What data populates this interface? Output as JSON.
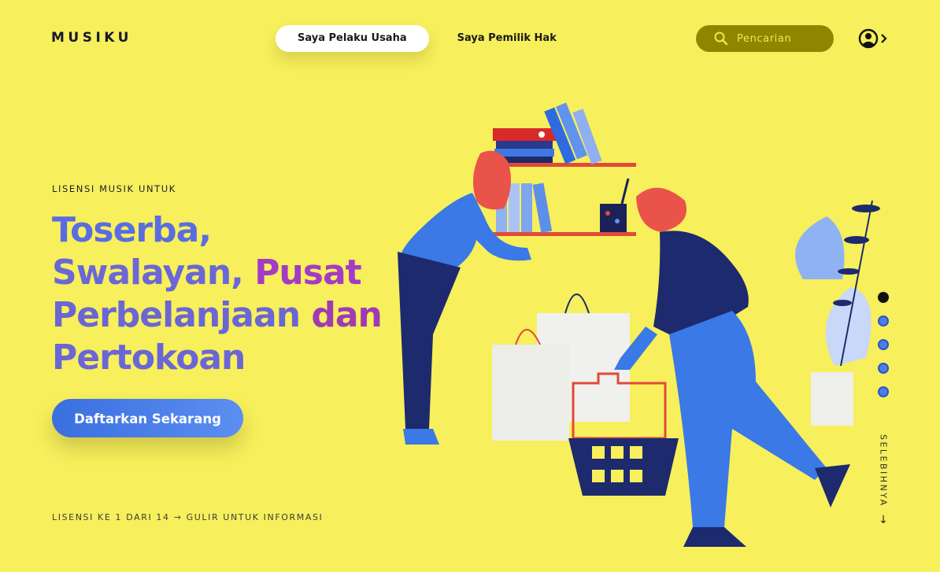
{
  "header": {
    "logo": "MUSIKU",
    "tabs": [
      {
        "label": "Saya Pelaku Usaha",
        "active": true
      },
      {
        "label": "Saya Pemilik Hak",
        "active": false
      }
    ],
    "search": {
      "placeholder": "Pencarian",
      "icon": "search-icon"
    },
    "account": {
      "icon": "user-circle-icon",
      "chevron": "chevron-right-icon"
    }
  },
  "hero": {
    "eyebrow": "LISENSI MUSIK UNTUK",
    "headline": {
      "line1": "Toserba,",
      "line2a": "Swalayan, ",
      "line2b": "Pusat",
      "line3a": "Perbelanjaan ",
      "line3b": "dan",
      "line4": "Pertokoan"
    },
    "cta": "Daftarkan Sekarang",
    "footer": "LISENSI KE 1 DARI 14 → GULIR UNTUK INFORMASI"
  },
  "pager": {
    "total": 5,
    "active_index": 0
  },
  "more": {
    "label": "SELEBIHNYA",
    "arrow": "↓"
  },
  "colors": {
    "background": "#f7ef5c",
    "search_bg": "#8f8600",
    "cta_blue": "#3a6fe0",
    "headline_blue": "#5a6de0",
    "headline_purple": "#a43bc6"
  }
}
